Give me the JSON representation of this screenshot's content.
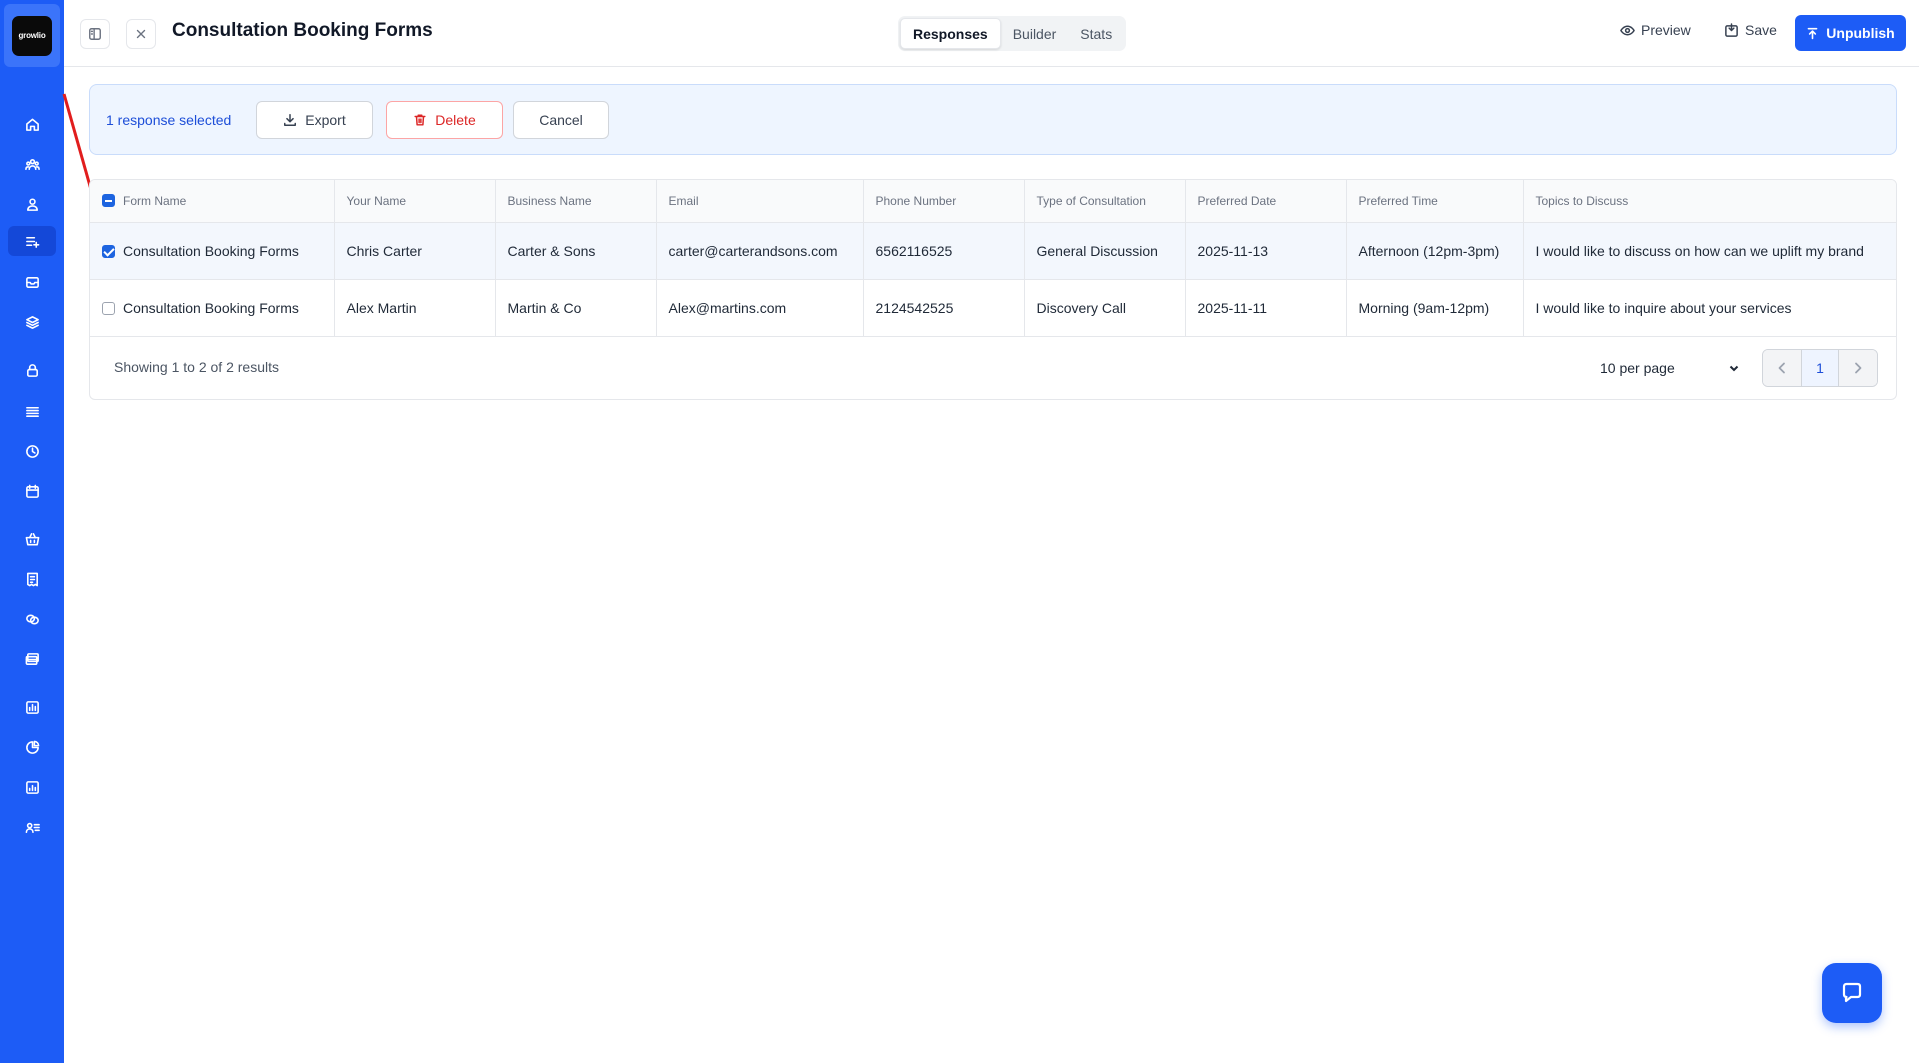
{
  "brand": {
    "logo_text": "growlio",
    "accent": "#1d5cf6"
  },
  "header": {
    "title": "Consultation Booking Forms",
    "tabs": [
      {
        "label": "Responses",
        "active": true
      },
      {
        "label": "Builder",
        "active": false
      },
      {
        "label": "Stats",
        "active": false
      }
    ],
    "preview_label": "Preview",
    "save_label": "Save",
    "unpublish_label": "Unpublish"
  },
  "sidebar": {
    "icons": [
      "home-icon",
      "users-group-icon",
      "user-icon",
      "list-plus-icon",
      "inbox-icon",
      "layers-icon",
      "lock-icon",
      "menu-icon",
      "clock-icon",
      "calendar-icon",
      "basket-icon",
      "receipt-icon",
      "coins-icon",
      "payments-icon",
      "chart-icon",
      "pie-chart-icon",
      "report-icon",
      "user-list-icon"
    ],
    "active": "list-plus-icon"
  },
  "selection": {
    "text": "1 response selected",
    "export_label": "Export",
    "delete_label": "Delete",
    "cancel_label": "Cancel"
  },
  "table": {
    "columns": [
      "Form Name",
      "Your Name",
      "Business Name",
      "Email",
      "Phone Number",
      "Type of Consultation",
      "Preferred Date",
      "Preferred Time",
      "Topics to Discuss"
    ],
    "rows": [
      {
        "selected": true,
        "cells": [
          "Consultation Booking Forms",
          "Chris Carter",
          "Carter & Sons",
          "carter@carterandsons.com",
          "6562116525",
          "General Discussion",
          "2025-11-13",
          "Afternoon (12pm-3pm)",
          "I would like to discuss on how can we uplift my brand"
        ]
      },
      {
        "selected": false,
        "cells": [
          "Consultation Booking Forms",
          "Alex Martin",
          "Martin & Co",
          "Alex@martins.com",
          "2124542525",
          "Discovery Call",
          "2025-11-11",
          "Morning (9am-12pm)",
          "I would like to inquire about your services"
        ]
      }
    ],
    "results_text": "Showing 1 to 2 of 2 results",
    "per_page": "10 per page",
    "current_page": "1"
  }
}
